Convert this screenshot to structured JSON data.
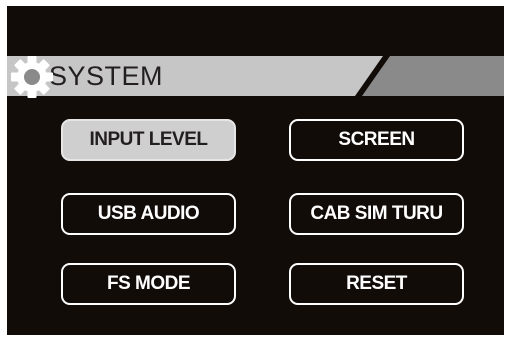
{
  "header": {
    "title": "SYSTEM",
    "icon": "gear-icon"
  },
  "menu": {
    "input_level": "INPUT LEVEL",
    "screen": "SCREEN",
    "usb_audio": "USB AUDIO",
    "cab_sim_turu": "CAB SIM TURU",
    "fs_mode": "FS MODE",
    "reset": "RESET",
    "selected": "INPUT LEVEL"
  },
  "colors": {
    "background": "#120c09",
    "header_light": "#c6c6c6",
    "header_dark": "#8a8a8a",
    "button_border": "#ffffff",
    "selected_fill": "#cfcfcf"
  }
}
